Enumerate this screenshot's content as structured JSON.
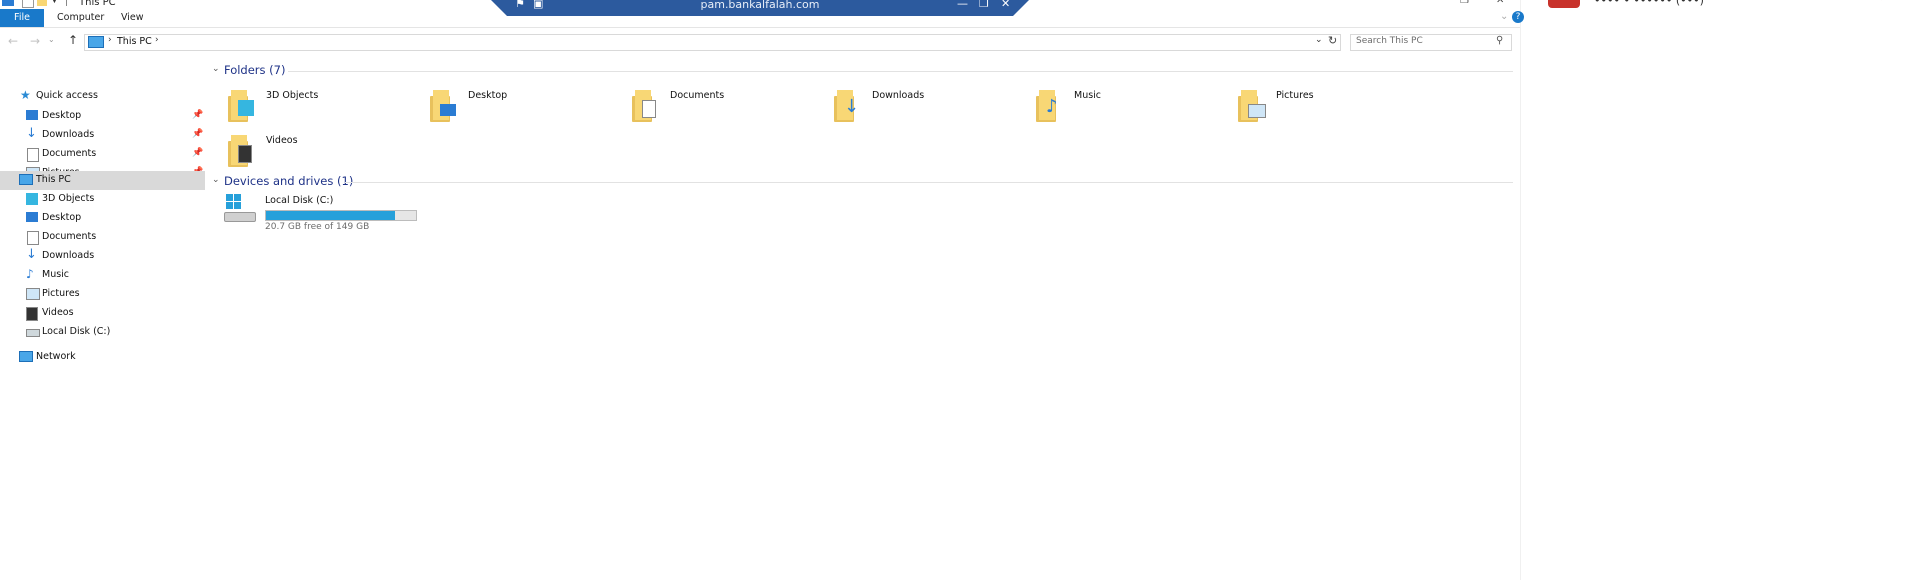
{
  "window": {
    "title": "This PC"
  },
  "ribbon": {
    "tabs": [
      "File",
      "Computer",
      "View"
    ]
  },
  "remote": {
    "host": "pam.bankalfalah.com"
  },
  "address": {
    "path": "This PC",
    "search_placeholder": "Search This PC"
  },
  "nav": {
    "quick_access": "Quick access",
    "quick_items": [
      "Desktop",
      "Downloads",
      "Documents",
      "Pictures"
    ],
    "this_pc": "This PC",
    "pc_items": [
      "3D Objects",
      "Desktop",
      "Documents",
      "Downloads",
      "Music",
      "Pictures",
      "Videos",
      "Local Disk (C:)"
    ],
    "network": "Network"
  },
  "folders": {
    "header": "Folders (7)",
    "items": [
      "3D Objects",
      "Desktop",
      "Documents",
      "Downloads",
      "Music",
      "Pictures",
      "Videos"
    ]
  },
  "devices": {
    "header": "Devices and drives (1)",
    "drive_name": "Local Disk (C:)",
    "free_text": "20.7 GB free of 149 GB",
    "used_fraction": 0.861
  },
  "colors": {
    "accent": "#1979ca",
    "drive_bar": "#26a0da",
    "group_header": "#1e3287",
    "selection": "#d9d9d9"
  },
  "right_panel": {
    "text": "•••• • •••••• (•••)"
  }
}
